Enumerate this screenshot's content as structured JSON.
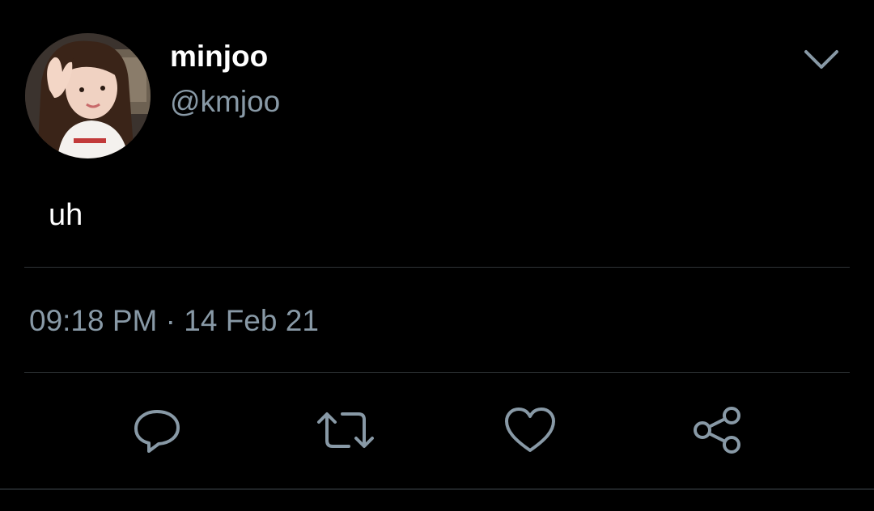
{
  "tweet": {
    "author": {
      "display_name": "minjoo",
      "handle": "@kmjoo"
    },
    "text": "uh",
    "meta": {
      "time": "09:18 PM",
      "separator": "·",
      "date": "14 Feb 21"
    },
    "actions": [
      {
        "name": "reply",
        "icon": "reply-icon"
      },
      {
        "name": "retweet",
        "icon": "retweet-icon"
      },
      {
        "name": "like",
        "icon": "heart-icon"
      },
      {
        "name": "share",
        "icon": "share-icon"
      }
    ],
    "menu_icon": "chevron-down-icon"
  },
  "colors": {
    "background": "#000000",
    "primary_text": "#ffffff",
    "secondary_text": "#8899a6",
    "divider": "#2f3336"
  }
}
